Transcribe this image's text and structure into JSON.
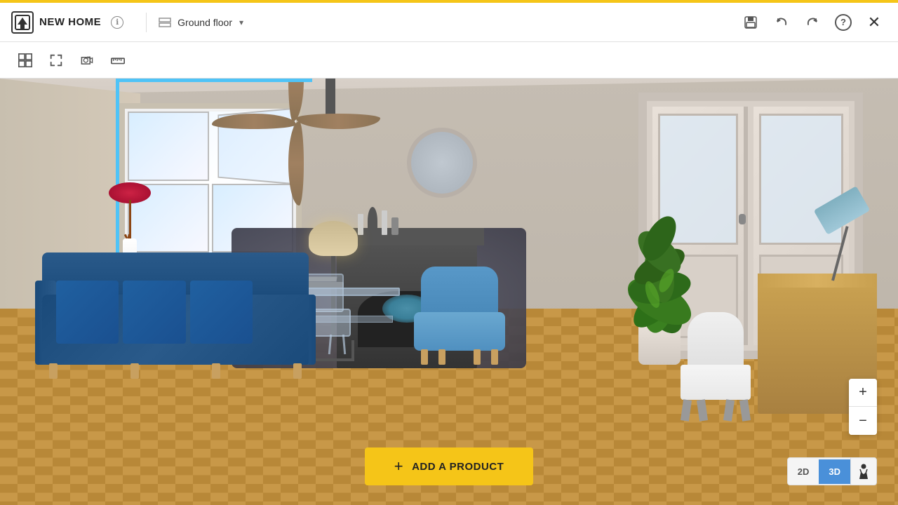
{
  "app": {
    "title": "NEW HOME",
    "floor_label": "Ground floor",
    "info_icon": "ℹ",
    "floor_icon": "⬛",
    "chevron": "▾"
  },
  "toolbar_right": {
    "save_label": "💾",
    "undo_label": "↩",
    "redo_label": "↪",
    "help_label": "?",
    "close_label": "✕"
  },
  "toolbar2": {
    "grid_label": "grid",
    "expand_label": "⤢",
    "camera_label": "📷",
    "ruler_label": "📏"
  },
  "add_product": {
    "plus": "+",
    "label": "ADD A PRODUCT"
  },
  "zoom": {
    "plus": "+",
    "minus": "−"
  },
  "view_mode": {
    "2d": "2D",
    "3d": "3D"
  }
}
